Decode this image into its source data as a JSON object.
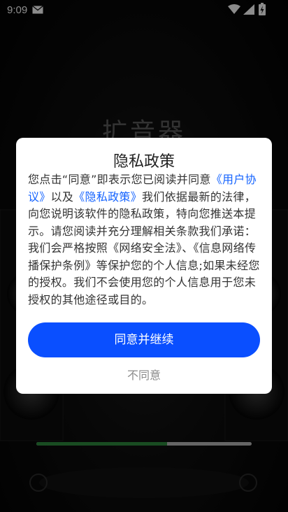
{
  "status_bar": {
    "time": "9:09"
  },
  "background": {
    "title": "扩音器",
    "progress": 0.606
  },
  "dialog": {
    "title": "隐私政策",
    "body": {
      "part1": "您点击“同意”即表示您已阅读并同意",
      "link_user_agreement": "《用户协议》",
      "part2": "以及",
      "link_privacy_policy": "《隐私政策》",
      "part3": "我们依据最新的法律，向您说明该软件的隐私政策，特向您推送本提示。请您阅读并充分理解相关条款我们承诺：我们会严格按照《网络安全法》、《信息网络传播保护条例》等保护您的个人信息;如果未经您的授权。我们不会使用您的个人信息用于您未授权的其他途径或目的。"
    },
    "agree_label": "同意并继续",
    "disagree_label": "不同意"
  },
  "colors": {
    "accent": "#0a4fff",
    "link": "#1463ff",
    "progress_fill": "#2e8b3e",
    "progress_track": "#b8b8b8"
  }
}
